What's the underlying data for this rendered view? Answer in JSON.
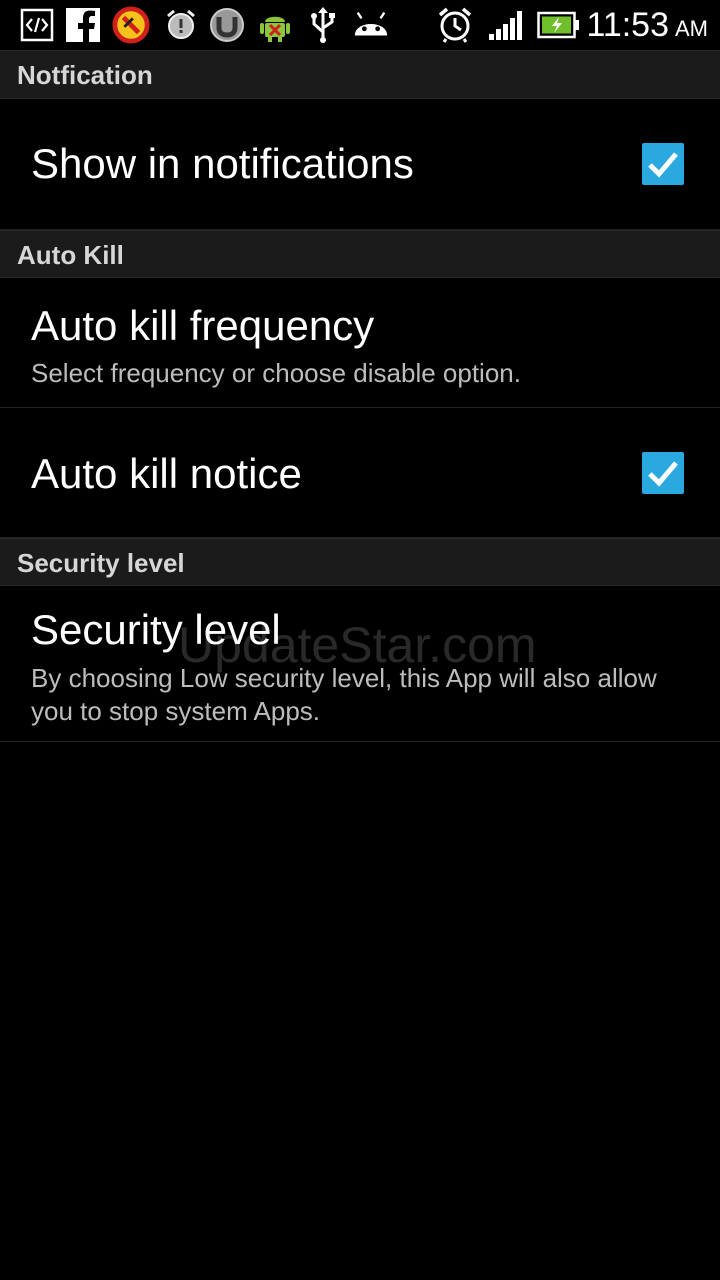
{
  "status_bar": {
    "icons": [
      "code-icon",
      "facebook-icon",
      "no-sync-icon",
      "alarm-clock-icon",
      "utorrent-icon",
      "android-debug-icon",
      "usb-icon",
      "android-icon",
      "alarm-icon",
      "signal-icon",
      "battery-charging-icon"
    ],
    "time": "11:53",
    "ampm": "AM"
  },
  "sections": {
    "notification": {
      "header": "Notfication",
      "show_in_notifications": {
        "title": "Show in notifications",
        "checked": true
      }
    },
    "auto_kill": {
      "header": "Auto Kill",
      "frequency": {
        "title": "Auto kill frequency",
        "summary": "Select frequency or choose disable option."
      },
      "notice": {
        "title": "Auto kill notice",
        "checked": true
      }
    },
    "security": {
      "header": "Security level",
      "level": {
        "title": "Security level",
        "summary": "By choosing Low security level, this App will also allow you to stop system Apps."
      }
    }
  },
  "watermark": "UpdateStar.com",
  "colors": {
    "checkbox": "#2aa9e0",
    "header_bg": "#1b1b1b",
    "background": "#000000"
  }
}
